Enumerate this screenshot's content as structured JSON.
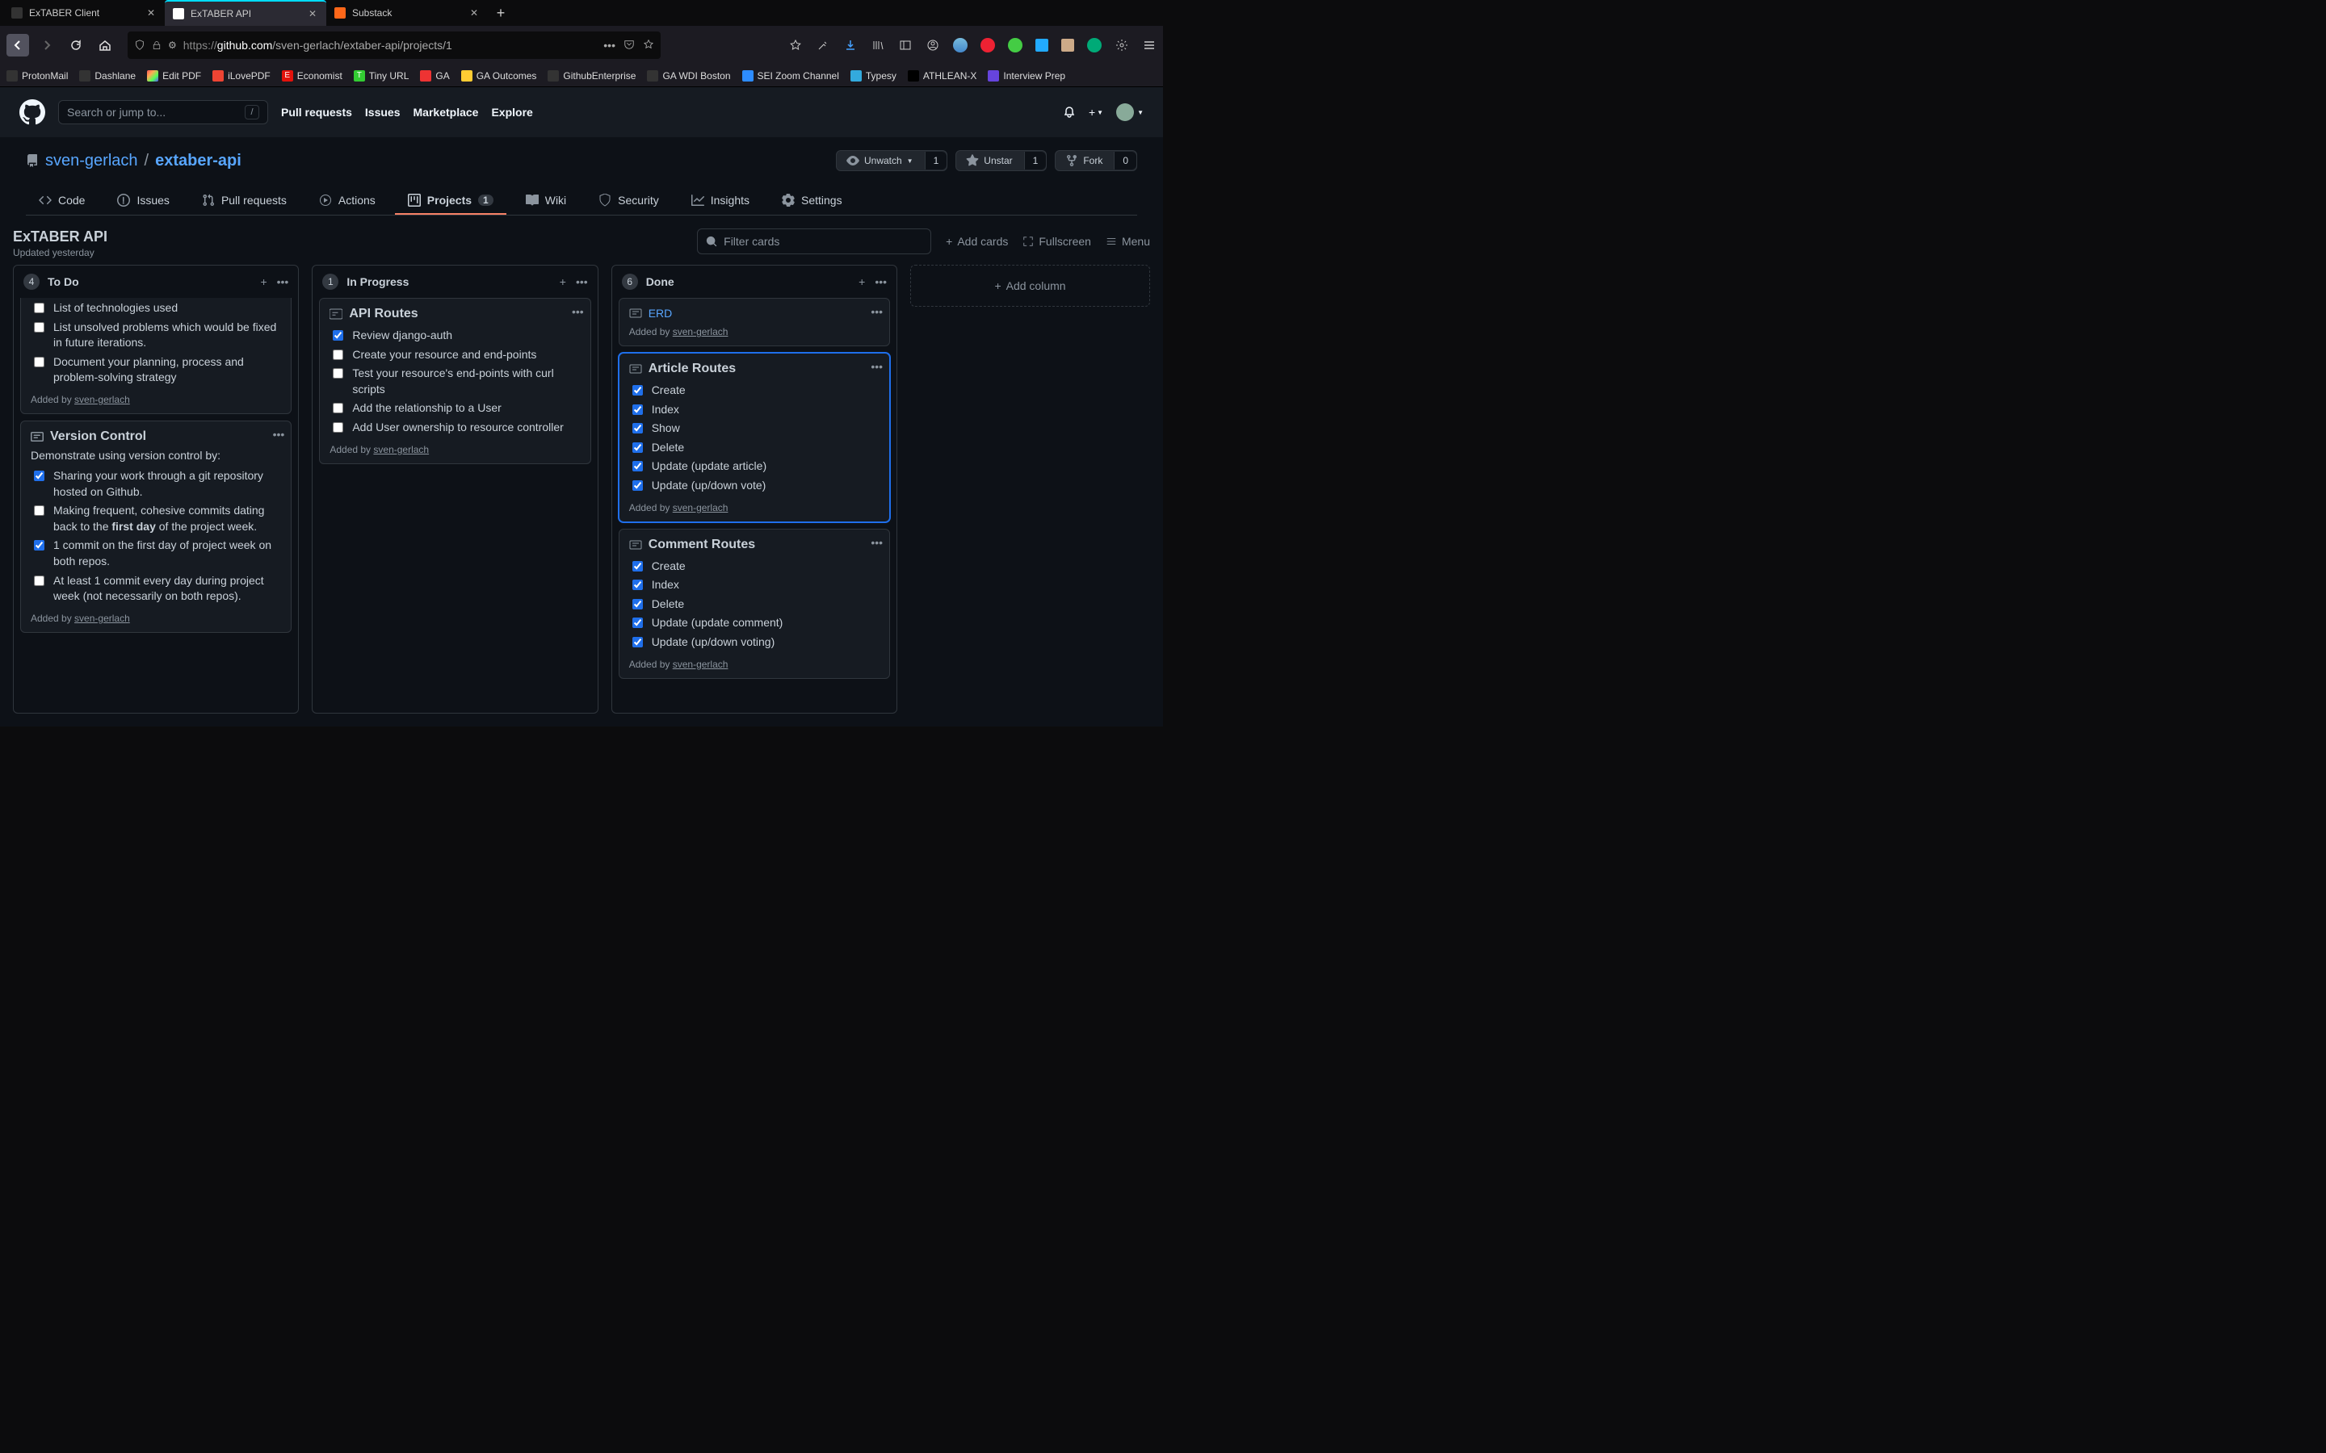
{
  "browser": {
    "tabs": [
      {
        "title": "ExTABER Client",
        "active": false
      },
      {
        "title": "ExTABER API",
        "active": true
      },
      {
        "title": "Substack",
        "active": false
      }
    ],
    "url": {
      "protocol": "https://",
      "domain": "github.com",
      "path": "/sven-gerlach/extaber-api/projects/1"
    },
    "bookmarks": [
      "ProtonMail",
      "Dashlane",
      "Edit PDF",
      "iLovePDF",
      "Economist",
      "Tiny URL",
      "GA",
      "GA Outcomes",
      "GithubEnterprise",
      "GA WDI Boston",
      "SEI Zoom Channel",
      "Typesy",
      "ATHLEAN-X",
      "Interview Prep"
    ]
  },
  "github": {
    "search_placeholder": "Search or jump to...",
    "nav": [
      "Pull requests",
      "Issues",
      "Marketplace",
      "Explore"
    ],
    "repo": {
      "owner": "sven-gerlach",
      "name": "extaber-api",
      "watch": {
        "label": "Unwatch",
        "count": "1"
      },
      "star": {
        "label": "Unstar",
        "count": "1"
      },
      "fork": {
        "label": "Fork",
        "count": "0"
      }
    },
    "tabs": {
      "code": "Code",
      "issues": "Issues",
      "pulls": "Pull requests",
      "actions": "Actions",
      "projects": "Projects",
      "projects_count": "1",
      "wiki": "Wiki",
      "security": "Security",
      "insights": "Insights",
      "settings": "Settings"
    },
    "project": {
      "title": "ExTABER API",
      "updated": "Updated yesterday",
      "filter_placeholder": "Filter cards",
      "add_cards": "Add cards",
      "fullscreen": "Fullscreen",
      "menu": "Menu",
      "add_column": "Add column"
    },
    "columns": [
      {
        "count": "4",
        "name": "To Do",
        "cards": [
          {
            "checks": [
              {
                "done": false,
                "text": "List of technologies used"
              },
              {
                "done": false,
                "text": "List unsolved problems which would be fixed in future iterations."
              },
              {
                "done": false,
                "text": "Document your planning, process and problem-solving strategy"
              }
            ],
            "added_by": "sven-gerlach"
          },
          {
            "title": "Version Control",
            "subtext": "Demonstrate using version control by:",
            "checks": [
              {
                "done": true,
                "text": "Sharing your work through a git repository hosted on Github."
              },
              {
                "done": false,
                "html": "Making frequent, cohesive commits dating back to the <b>first day</b> of the project week."
              },
              {
                "done": true,
                "text": "1 commit on the first day of project week on both repos."
              },
              {
                "done": false,
                "text": "At least 1 commit every day during project week (not necessarily on both repos)."
              }
            ],
            "added_by": "sven-gerlach"
          }
        ]
      },
      {
        "count": "1",
        "name": "In Progress",
        "cards": [
          {
            "title": "API Routes",
            "checks": [
              {
                "done": true,
                "text": "Review django-auth"
              },
              {
                "done": false,
                "text": "Create your resource and end-points"
              },
              {
                "done": false,
                "text": "Test your resource's end-points with curl scripts"
              },
              {
                "done": false,
                "text": "Add the relationship to a User"
              },
              {
                "done": false,
                "text": "Add User ownership to resource controller"
              }
            ],
            "added_by": "sven-gerlach"
          }
        ]
      },
      {
        "count": "6",
        "name": "Done",
        "cards": [
          {
            "link_title": "ERD",
            "added_by": "sven-gerlach"
          },
          {
            "title": "Article Routes",
            "highlight": true,
            "checks": [
              {
                "done": true,
                "text": "Create"
              },
              {
                "done": true,
                "text": "Index"
              },
              {
                "done": true,
                "text": "Show"
              },
              {
                "done": true,
                "text": "Delete"
              },
              {
                "done": true,
                "text": "Update (update article)"
              },
              {
                "done": true,
                "text": "Update (up/down vote)"
              }
            ],
            "added_by": "sven-gerlach"
          },
          {
            "title": "Comment Routes",
            "checks": [
              {
                "done": true,
                "text": "Create"
              },
              {
                "done": true,
                "text": "Index"
              },
              {
                "done": true,
                "text": "Delete"
              },
              {
                "done": true,
                "text": "Update (update comment)"
              },
              {
                "done": true,
                "text": "Update (up/down voting)"
              }
            ],
            "added_by": "sven-gerlach"
          }
        ]
      }
    ]
  }
}
